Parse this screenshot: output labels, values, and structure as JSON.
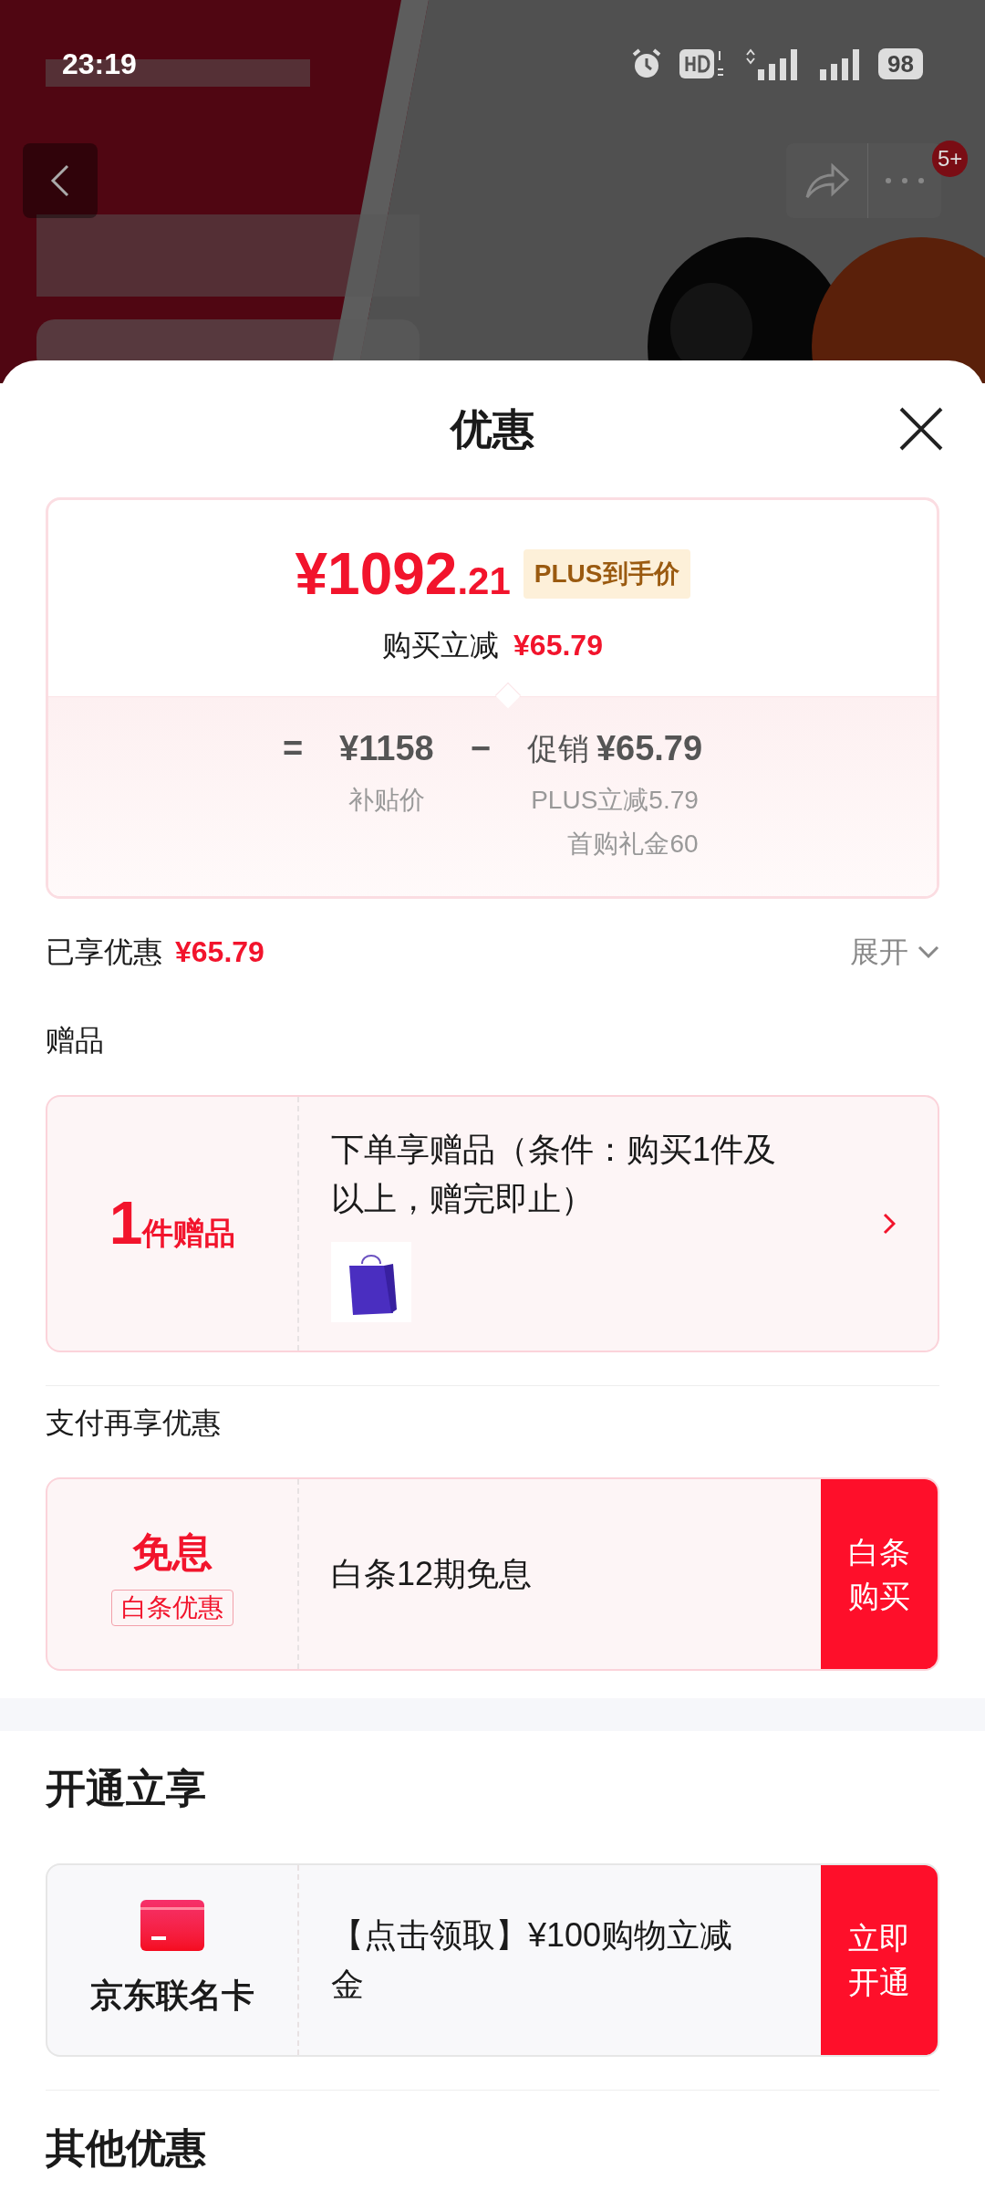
{
  "status_bar": {
    "time": "23:19",
    "battery": "98"
  },
  "header": {
    "badge": "5+"
  },
  "sheet": {
    "title": "优惠",
    "price_card": {
      "price_main": "¥1092",
      "price_decimal": ".21",
      "price_tag": "PLUS到手价",
      "saving_label": "购买立减",
      "saving_amount": "¥65.79",
      "breakdown": {
        "equals": "=",
        "base_price": "¥1158",
        "base_label": "补贴价",
        "minus": "−",
        "promo_label": "促销",
        "promo_amount": "¥65.79",
        "promo_details": [
          "PLUS立减5.79",
          "首购礼金60"
        ]
      }
    },
    "enjoyed": {
      "label": "已享优惠",
      "amount": "¥65.79",
      "expand": "展开",
      "expanded": false
    },
    "sections": [
      {
        "kind": "gift",
        "heading": "赠品",
        "count": "1",
        "unit": "件赠品",
        "text": "下单享赠品（条件：购买1件及以上，赠完即止）"
      },
      {
        "kind": "payment",
        "heading": "支付再享优惠",
        "title": "免息",
        "tag": "白条优惠",
        "text": "白条12期免息",
        "action": "白条购买"
      },
      {
        "kind": "card",
        "heading": "开通立享",
        "title": "京东联名卡",
        "text": "【点击领取】¥100购物立减金",
        "action": "立即开通"
      },
      {
        "kind": "heading",
        "heading": "其他优惠"
      }
    ]
  }
}
